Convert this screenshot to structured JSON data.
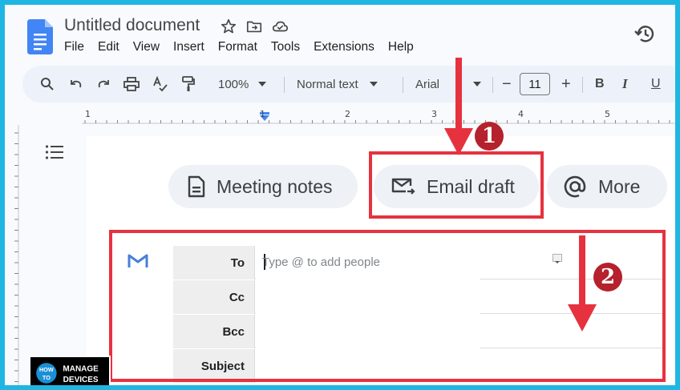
{
  "document": {
    "title": "Untitled document"
  },
  "menu": [
    "File",
    "Edit",
    "View",
    "Insert",
    "Format",
    "Tools",
    "Extensions",
    "Help"
  ],
  "toolbar": {
    "zoom": "100%",
    "style": "Normal text",
    "font": "Arial",
    "font_size": "11",
    "bold": "B",
    "italic": "I",
    "underline": "U",
    "minus": "−",
    "plus": "+"
  },
  "ruler": {
    "marks": [
      "1",
      "1",
      "2",
      "3",
      "4",
      "5"
    ]
  },
  "chips": {
    "meeting_notes": "Meeting notes",
    "email_draft": "Email draft",
    "more": "More"
  },
  "annotations": {
    "step1": "1",
    "step2": "2"
  },
  "email_draft": {
    "fields": {
      "to": "To",
      "cc": "Cc",
      "bcc": "Bcc",
      "subject": "Subject"
    },
    "to_placeholder": "Type @ to add people"
  },
  "watermark": {
    "line1a": "HOW",
    "line1b": "MANAGE",
    "line2a": "TO",
    "line2b": "DEVICES"
  },
  "colors": {
    "frame_border": "#1fb6e3",
    "annotation_red": "#e6323f",
    "badge_red": "#b5212c",
    "docs_blue": "#4285f4"
  }
}
